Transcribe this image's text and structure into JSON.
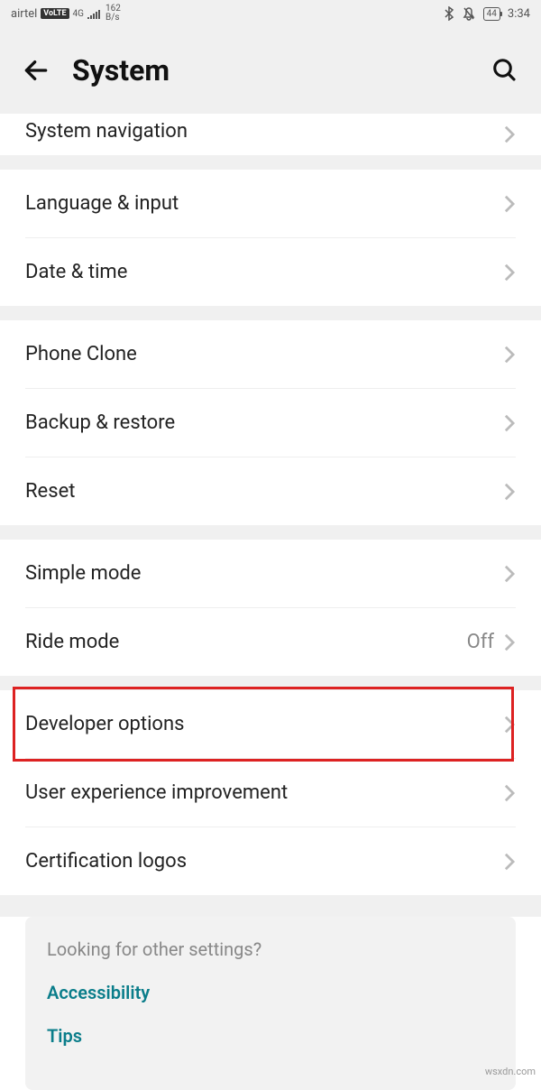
{
  "status": {
    "carrier": "airtel",
    "volte": "VoLTE",
    "network": "4G",
    "speed_top": "162",
    "speed_bottom": "B/s",
    "battery": "44",
    "time": "3:34"
  },
  "header": {
    "title": "System"
  },
  "groups": [
    {
      "items": [
        {
          "label": "System navigation",
          "value": "",
          "partial": true
        }
      ]
    },
    {
      "items": [
        {
          "label": "Language & input",
          "value": ""
        },
        {
          "label": "Date & time",
          "value": ""
        }
      ]
    },
    {
      "items": [
        {
          "label": "Phone Clone",
          "value": ""
        },
        {
          "label": "Backup & restore",
          "value": ""
        },
        {
          "label": "Reset",
          "value": ""
        }
      ]
    },
    {
      "items": [
        {
          "label": "Simple mode",
          "value": ""
        },
        {
          "label": "Ride mode",
          "value": "Off"
        }
      ]
    },
    {
      "items": [
        {
          "label": "Developer options",
          "value": "",
          "highlight": true
        },
        {
          "label": "User experience improvement",
          "value": ""
        },
        {
          "label": "Certification logos",
          "value": ""
        }
      ]
    }
  ],
  "footer": {
    "prompt": "Looking for other settings?",
    "links": [
      "Accessibility",
      "Tips"
    ]
  },
  "watermark": "wsxdn.com"
}
